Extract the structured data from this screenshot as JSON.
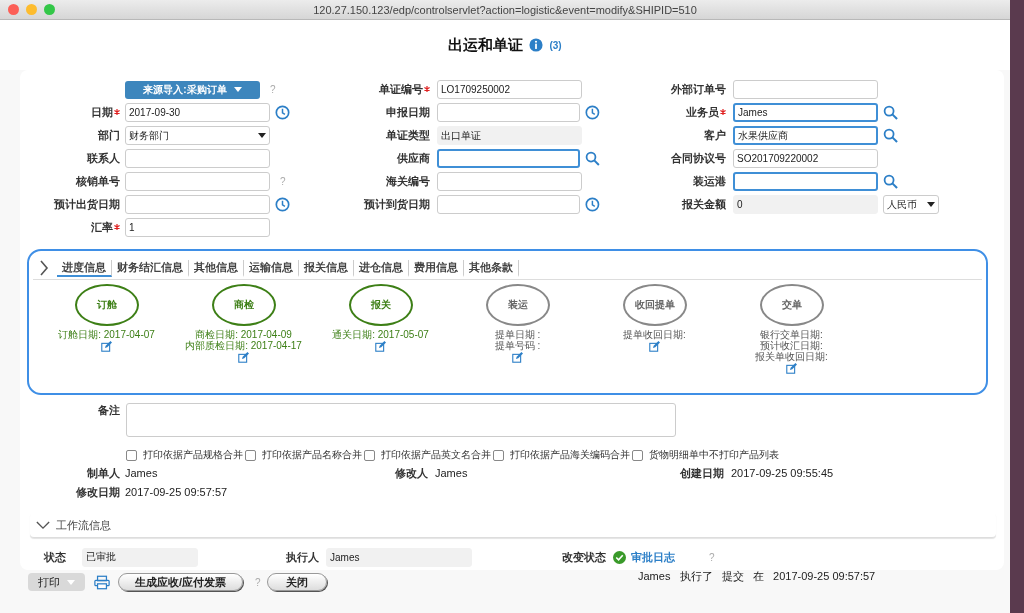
{
  "window": {
    "url": "120.27.150.123/edp/controlservlet?action=logistic&event=modify&SHIPID=510"
  },
  "page": {
    "title": "出运和单证",
    "count": "(3)"
  },
  "form_columns": [
    [
      {
        "kind": "button",
        "value": "来源导入:采购订单",
        "help": "?"
      },
      {
        "kind": "date",
        "label": "日期",
        "required": true,
        "value": "2017-09-30"
      },
      {
        "kind": "select",
        "label": "部门",
        "value": "财务部门"
      },
      {
        "kind": "text",
        "label": "联系人"
      },
      {
        "kind": "text",
        "label": "核销单号",
        "help": "?"
      },
      {
        "kind": "date",
        "label": "预计出货日期"
      },
      {
        "kind": "text",
        "label": "汇率",
        "required": true,
        "value": "1"
      }
    ],
    [
      {
        "kind": "text",
        "label": "单证编号",
        "required": true,
        "value": "LO1709250002"
      },
      {
        "kind": "date",
        "label": "申报日期"
      },
      {
        "kind": "readonly",
        "label": "单证类型",
        "value": "出口单证"
      },
      {
        "kind": "lookup",
        "label": "供应商"
      },
      {
        "kind": "text",
        "label": "海关编号"
      },
      {
        "kind": "date",
        "label": "预计到货日期"
      }
    ],
    [
      {
        "kind": "text",
        "label": "外部订单号"
      },
      {
        "kind": "lookup",
        "label": "业务员",
        "required": true,
        "value": "James"
      },
      {
        "kind": "lookup",
        "label": "客户",
        "value": "水果供应商"
      },
      {
        "kind": "text",
        "label": "合同协议号",
        "value": "SO201709220002"
      },
      {
        "kind": "lookup",
        "label": "装运港"
      },
      {
        "kind": "readonly",
        "label": "报关金额",
        "value": "0",
        "currency": "人民币"
      }
    ]
  ],
  "tabs": [
    {
      "label": "进度信息",
      "selected": true
    },
    {
      "label": "财务结汇信息",
      "selected": false
    },
    {
      "label": "其他信息",
      "selected": false
    },
    {
      "label": "运输信息",
      "selected": false
    },
    {
      "label": "报关信息",
      "selected": false
    },
    {
      "label": "进仓信息",
      "selected": false
    },
    {
      "label": "费用信息",
      "selected": false
    },
    {
      "label": "其他条款",
      "selected": false
    }
  ],
  "progress_steps": [
    {
      "label": "订舱",
      "done": true,
      "details": [
        "订舱日期: 2017-04-07"
      ]
    },
    {
      "label": "商检",
      "done": true,
      "details": [
        "商检日期: 2017-04-09",
        "内部质检日期: 2017-04-17"
      ]
    },
    {
      "label": "报关",
      "done": true,
      "details": [
        "通关日期: 2017-05-07"
      ]
    },
    {
      "label": "装运",
      "done": false,
      "details": [
        "提单日期 :",
        "提单号码 :"
      ]
    },
    {
      "label": "收回提单",
      "done": false,
      "details": [
        "提单收回日期:"
      ]
    },
    {
      "label": "交单",
      "done": false,
      "details": [
        "银行交单日期:",
        "预计收汇日期:",
        "报关单收回日期:"
      ]
    }
  ],
  "remarks": {
    "label": "备注"
  },
  "print_options": [
    {
      "label": "打印依据产品规格合并",
      "checked": false
    },
    {
      "label": "打印依据产品名称合并",
      "checked": false
    },
    {
      "label": "打印依据产品英文名合并",
      "checked": false
    },
    {
      "label": "打印依据产品海关编码合并",
      "checked": false
    },
    {
      "label": "货物明细单中不打印产品列表",
      "checked": false
    }
  ],
  "record_info": [
    {
      "label": "制单人",
      "value": "James"
    },
    {
      "label": "修改人",
      "value": "James"
    },
    {
      "label": "创建日期",
      "value": "2017-09-25 09:55:45"
    },
    {
      "label": "修改日期",
      "value": "2017-09-25 09:57:57"
    }
  ],
  "workflow": {
    "title": "工作流信息",
    "expanded": true,
    "status_label": "状态",
    "status": "已审批",
    "executor_label": "执行人",
    "executor": "James",
    "change_label": "改变状态",
    "log_link": "审批日志",
    "help": "?",
    "log_entry": "James   执行了   提交   在   2017-09-25 09:57:57"
  },
  "buttons": {
    "print": "打印",
    "generate": "生成应收/应付发票",
    "help": "?",
    "close": "关闭"
  }
}
